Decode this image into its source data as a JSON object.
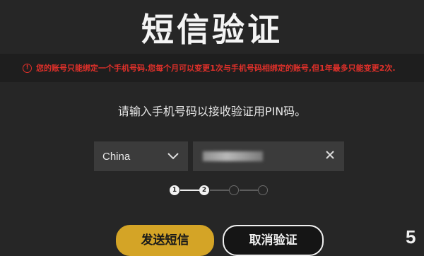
{
  "title": "短信验证",
  "warning": {
    "icon": "alert-circle-icon",
    "color": "#e0302a",
    "text": "您的账号只能绑定一个手机号码.您每个月可以变更1次与手机号码相绑定的账号,但1年最多只能变更2次."
  },
  "instruction": "请输入手机号码以接收验证用PIN码。",
  "country_select": {
    "value": "China",
    "icon": "chevron-down-icon"
  },
  "phone_input": {
    "value": "",
    "clear_icon": "close-icon"
  },
  "stepper": {
    "steps": [
      "1",
      "2"
    ],
    "current": 2,
    "total": 4
  },
  "buttons": {
    "send": "发送短信",
    "cancel": "取消验证"
  },
  "colors": {
    "accent": "#d4a426",
    "background": "#262626",
    "warning": "#e0302a"
  },
  "corner_mark": "5"
}
